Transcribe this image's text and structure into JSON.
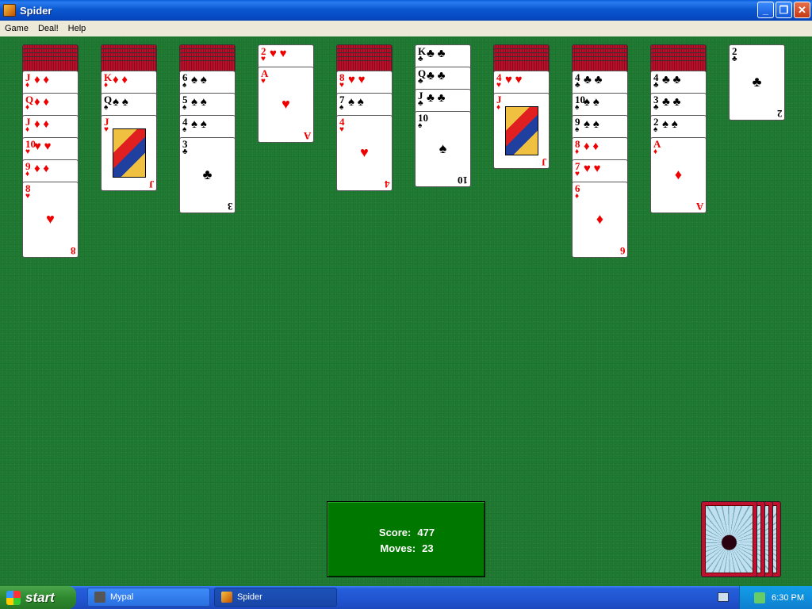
{
  "window": {
    "title": "Spider",
    "minimize_label": "_",
    "maximize_label": "❐",
    "close_label": "✕"
  },
  "menu": {
    "items": [
      {
        "label": "Game"
      },
      {
        "label": "Deal!"
      },
      {
        "label": "Help"
      }
    ]
  },
  "score": {
    "score_label": "Score:",
    "score_value": "477",
    "moves_label": "Moves:",
    "moves_value": "23"
  },
  "tableau": [
    {
      "hidden": 5,
      "cards": [
        {
          "rank": "J",
          "suit": "♦"
        },
        {
          "rank": "Q",
          "suit": "♦"
        },
        {
          "rank": "J",
          "suit": "♦"
        },
        {
          "rank": "10",
          "suit": "♥"
        },
        {
          "rank": "9",
          "suit": "♦"
        },
        {
          "rank": "8",
          "suit": "♥"
        }
      ]
    },
    {
      "hidden": 5,
      "cards": [
        {
          "rank": "K",
          "suit": "♦"
        },
        {
          "rank": "Q",
          "suit": "♠"
        },
        {
          "rank": "J",
          "suit": "♥"
        }
      ]
    },
    {
      "hidden": 5,
      "cards": [
        {
          "rank": "6",
          "suit": "♠"
        },
        {
          "rank": "5",
          "suit": "♠"
        },
        {
          "rank": "4",
          "suit": "♠"
        },
        {
          "rank": "3",
          "suit": "♣"
        }
      ]
    },
    {
      "hidden": 0,
      "cards": [
        {
          "rank": "2",
          "suit": "♥"
        },
        {
          "rank": "A",
          "suit": "♥"
        }
      ]
    },
    {
      "hidden": 5,
      "cards": [
        {
          "rank": "8",
          "suit": "♥"
        },
        {
          "rank": "7",
          "suit": "♠"
        },
        {
          "rank": "4",
          "suit": "♥"
        }
      ]
    },
    {
      "hidden": 0,
      "cards": [
        {
          "rank": "K",
          "suit": "♣"
        },
        {
          "rank": "Q",
          "suit": "♣"
        },
        {
          "rank": "J",
          "suit": "♣"
        },
        {
          "rank": "10",
          "suit": "♠"
        }
      ]
    },
    {
      "hidden": 5,
      "cards": [
        {
          "rank": "4",
          "suit": "♥"
        },
        {
          "rank": "J",
          "suit": "♦"
        }
      ]
    },
    {
      "hidden": 5,
      "cards": [
        {
          "rank": "4",
          "suit": "♣"
        },
        {
          "rank": "10",
          "suit": "♠"
        },
        {
          "rank": "9",
          "suit": "♠"
        },
        {
          "rank": "8",
          "suit": "♦"
        },
        {
          "rank": "7",
          "suit": "♥"
        },
        {
          "rank": "6",
          "suit": "♦"
        }
      ]
    },
    {
      "hidden": 5,
      "cards": [
        {
          "rank": "4",
          "suit": "♣"
        },
        {
          "rank": "3",
          "suit": "♣"
        },
        {
          "rank": "2",
          "suit": "♠"
        },
        {
          "rank": "A",
          "suit": "♦"
        }
      ]
    },
    {
      "hidden": 0,
      "cards": [
        {
          "rank": "2",
          "suit": "♣"
        }
      ]
    }
  ],
  "stock": {
    "remaining_deals": 4
  },
  "taskbar": {
    "start_label": "start",
    "tasks": [
      {
        "label": "Mypal"
      },
      {
        "label": "Spider"
      }
    ],
    "clock": "6:30 PM"
  }
}
